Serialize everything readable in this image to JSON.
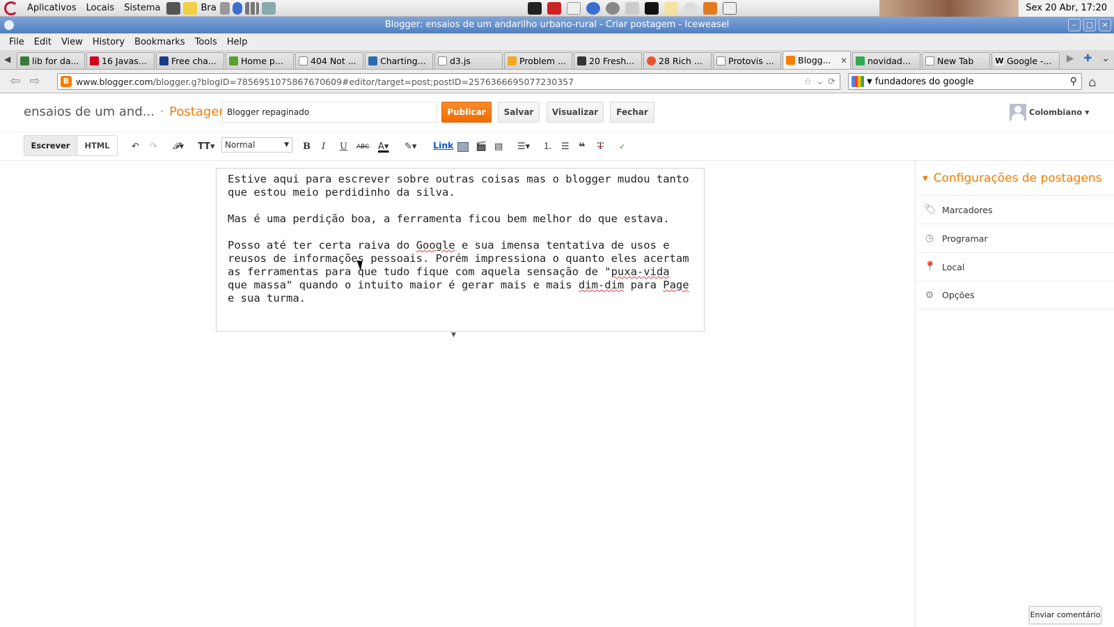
{
  "gnome_panel": {
    "menus": [
      "Aplicativos",
      "Locais",
      "Sistema"
    ],
    "bra_label": "Bra",
    "clock": "Sex 20 Abr, 17:20"
  },
  "window": {
    "title": "Blogger: ensaios de um andarilho urbano-rural - Criar postagem - Iceweasel"
  },
  "menubar": [
    "File",
    "Edit",
    "View",
    "History",
    "Bookmarks",
    "Tools",
    "Help"
  ],
  "tabs": [
    {
      "label": "lib for da...",
      "color": "#3b7a3b"
    },
    {
      "label": "16 Javas...",
      "color": "#d0021b"
    },
    {
      "label": "Free cha...",
      "color": "#1a3b8a"
    },
    {
      "label": "Home p...",
      "color": "#5aa02c"
    },
    {
      "label": "404 Not ...",
      "color": "#ffffff"
    },
    {
      "label": "Charting...",
      "color": "#2b6cb0"
    },
    {
      "label": "d3.js",
      "color": "#ffffff"
    },
    {
      "label": "Problem ...",
      "color": "#f5a623"
    },
    {
      "label": "20 Fresh...",
      "color": "#333333"
    },
    {
      "label": "28 Rich ...",
      "color": "#e8542e"
    },
    {
      "label": "Protovis ...",
      "color": "#ffffff"
    },
    {
      "label": "Blogg...",
      "color": "#f57d00"
    },
    {
      "label": "novidad...",
      "color": "#34a853"
    },
    {
      "label": "New Tab",
      "color": "#ffffff"
    },
    {
      "label": "Google -...",
      "color": "#eeeeee"
    }
  ],
  "navbar": {
    "url_host": "www.blogger.com",
    "url_rest": "/blogger.g?blogID=7856951075867670609#editor/target=post;postID=2576366695077230357",
    "search_value": "fundadores do google"
  },
  "blogger": {
    "blog_name": "ensaios de um and...",
    "separator": "·",
    "section": "Postagem",
    "post_title": "Blogger repaginado",
    "publish": "Publicar",
    "save": "Salvar",
    "preview": "Visualizar",
    "close": "Fechar",
    "user": "Colombiano"
  },
  "toolbar": {
    "write": "Escrever",
    "html": "HTML",
    "format": "Normal",
    "link": "Link"
  },
  "post": {
    "p1": "Estive aqui para escrever sobre outras coisas mas o blogger mudou tanto que estou meio perdidinho da silva.",
    "p2": "Mas é uma perdição boa, a ferramenta ficou bem melhor do que estava.",
    "p3_a": "Posso até ter certa raiva do ",
    "p3_google": "Google",
    "p3_b": " e sua imensa tentativa de usos e reusos de informações pessoais. Porém impressiona o quanto eles acertam as ferramentas para que tudo fique com aquela sensação de \"",
    "p3_puxa": "puxa-vida",
    "p3_c": " que massa\" quando o intuito maior é gerar mais e mais ",
    "p3_dimdim": "dim-dim",
    "p3_d": " para ",
    "p3_page": "Page",
    "p3_e": " e sua turma."
  },
  "settings": {
    "title": "Configurações de postagens",
    "items": [
      "Marcadores",
      "Programar",
      "Local",
      "Opções"
    ]
  },
  "feedback": "Enviar comentário"
}
